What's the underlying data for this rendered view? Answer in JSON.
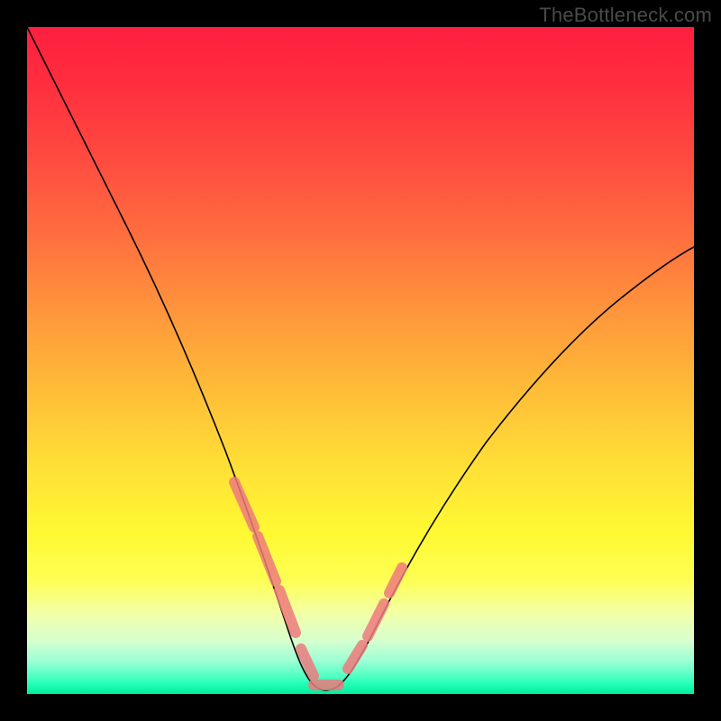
{
  "watermark": "TheBottleneck.com",
  "colors": {
    "marker": "#ed7a7d",
    "curve": "#000000",
    "background_top": "#ff1f3f",
    "background_bottom": "#00ee9e",
    "frame": "#000000"
  },
  "chart_data": {
    "type": "line",
    "title": "",
    "xlabel": "",
    "ylabel": "",
    "xlim": [
      0,
      100
    ],
    "ylim": [
      0,
      100
    ],
    "grid": false,
    "legend": false,
    "series": [
      {
        "name": "bottleneck-curve",
        "x": [
          0,
          5,
          10,
          15,
          20,
          25,
          28,
          30,
          32,
          34,
          36,
          38,
          40,
          42,
          44,
          46,
          50,
          55,
          60,
          65,
          70,
          75,
          80,
          85,
          90,
          95,
          100
        ],
        "y": [
          100,
          87,
          74,
          62,
          50,
          38,
          30,
          25,
          20,
          15,
          10,
          6,
          3,
          1.5,
          1,
          2,
          5,
          11,
          18,
          25,
          32,
          38,
          44,
          49,
          54,
          58,
          62
        ]
      }
    ],
    "markers": [
      {
        "x_range": [
          27,
          36
        ],
        "y_range": [
          30,
          8
        ],
        "side": "left-slope"
      },
      {
        "x_range": [
          38,
          47
        ],
        "y_range": [
          1,
          3
        ],
        "side": "valley-floor"
      },
      {
        "x_range": [
          48,
          53
        ],
        "y_range": [
          5,
          12
        ],
        "side": "right-slope"
      }
    ],
    "annotations": []
  }
}
